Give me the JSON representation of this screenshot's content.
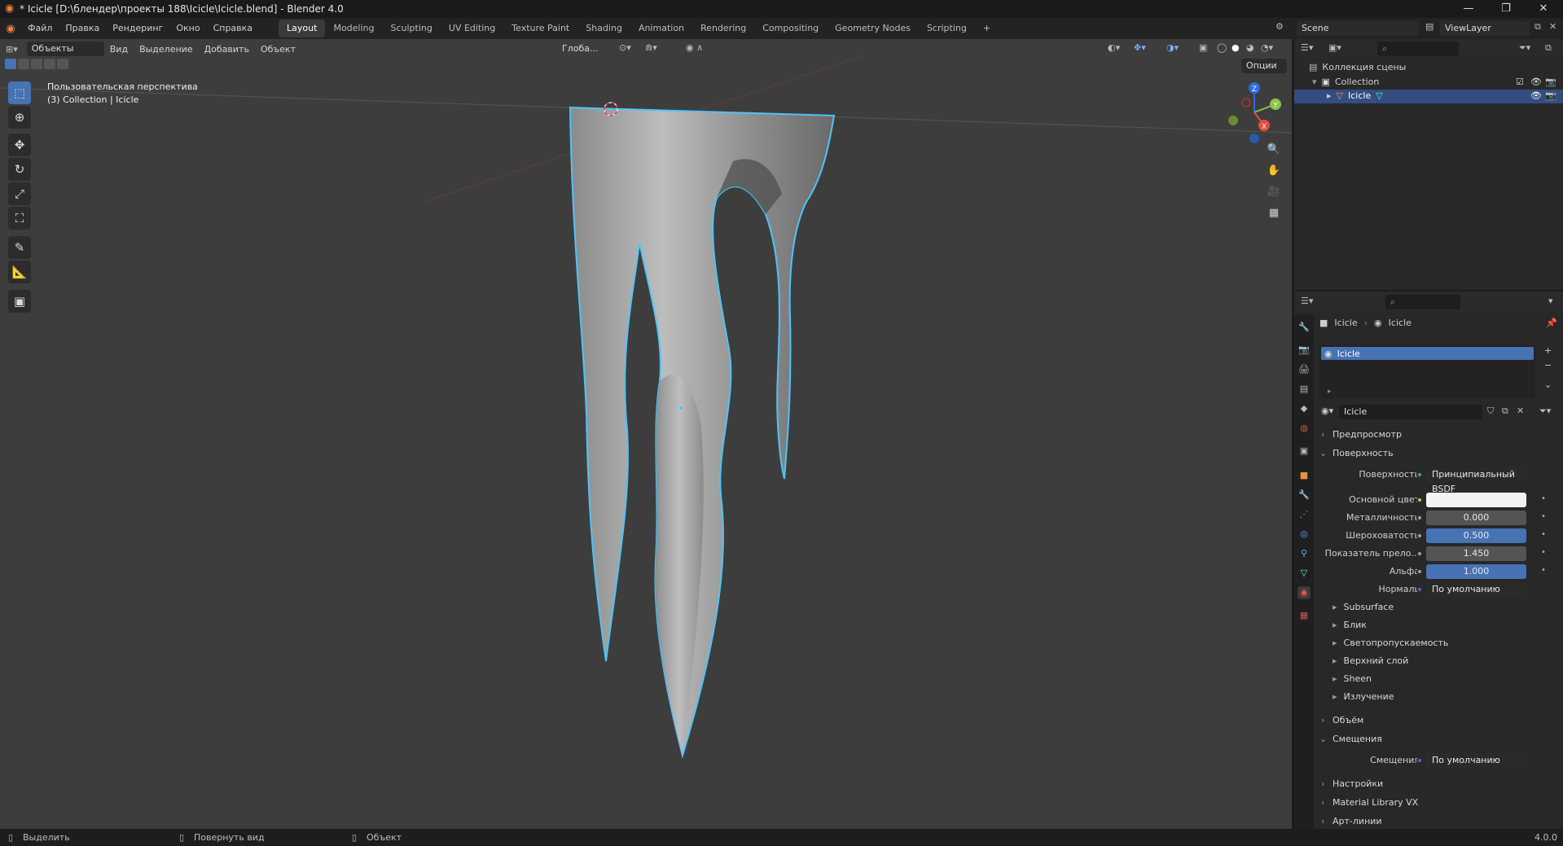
{
  "window": {
    "title": "* Icicle [D:\\блендер\\проекты 188\\Icicle\\Icicle.blend] - Blender 4.0",
    "controls": [
      "—",
      "❐",
      "✕"
    ]
  },
  "menu": {
    "items": [
      "Файл",
      "Правка",
      "Рендеринг",
      "Окно",
      "Справка"
    ],
    "workspaces": [
      "Layout",
      "Modeling",
      "Sculpting",
      "UV Editing",
      "Texture Paint",
      "Shading",
      "Animation",
      "Rendering",
      "Compositing",
      "Geometry Nodes",
      "Scripting"
    ],
    "active_workspace": "Layout",
    "add_tab": "+",
    "scene": "Scene",
    "view_layer": "ViewLayer"
  },
  "viewport": {
    "mode": "Объекты",
    "menus": [
      "Вид",
      "Выделение",
      "Добавить",
      "Объект"
    ],
    "transform_orientation": "Глоба...",
    "options_label": "Опции",
    "overlay_title": "Пользовательская перспектива",
    "overlay_subtitle": "(3) Collection | Icicle",
    "gizmo_axes": {
      "x": "X",
      "y": "Y",
      "z": "Z"
    }
  },
  "outliner": {
    "root": "Коллекция сцены",
    "collection": "Collection",
    "object": "Icicle"
  },
  "properties": {
    "breadcrumb_object": "Icicle",
    "breadcrumb_material": "Icicle",
    "slot_name": "Icicle",
    "material_name": "Icicle",
    "sections": {
      "preview": "Предпросмотр",
      "surface": "Поверхность",
      "volume": "Объём",
      "displacement": "Смещения",
      "settings": "Настройки",
      "material_library": "Material Library VX",
      "line_art": "Арт-линии"
    },
    "surface_rows": [
      {
        "label": "Поверхность",
        "value": "Принципиальный BSDF",
        "style": "plain"
      },
      {
        "label": "Основной цвет",
        "value": "",
        "style": "white"
      },
      {
        "label": "Металличность",
        "value": "0.000",
        "style": "gray"
      },
      {
        "label": "Шероховатость",
        "value": "0.500",
        "style": "blue"
      },
      {
        "label": "Показатель прело...",
        "value": "1.450",
        "style": "gray"
      },
      {
        "label": "Альфа",
        "value": "1.000",
        "style": "blue"
      },
      {
        "label": "Нормаль",
        "value": "По умолчанию",
        "style": "plain"
      }
    ],
    "subpanels": [
      "Subsurface",
      "Блик",
      "Светопропускаемость",
      "Верхний слой",
      "Sheen",
      "Излучение"
    ],
    "displacement_row": {
      "label": "Смещения",
      "value": "По умолчанию"
    }
  },
  "statusbar": {
    "select": "Выделить",
    "rotate": "Повернуть вид",
    "object": "Объект",
    "version": "4.0.0"
  },
  "colors": {
    "accent": "#4772b3",
    "selection_outline": "#4fc3f7",
    "viewport_bg": "#3d3d3d"
  }
}
